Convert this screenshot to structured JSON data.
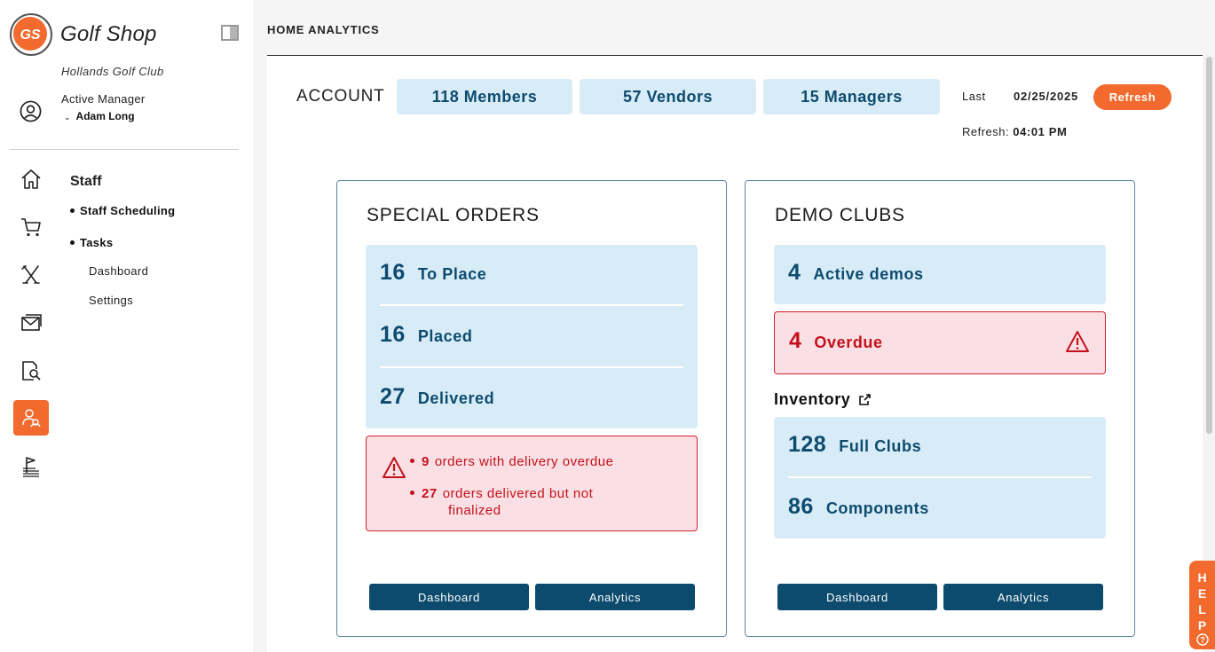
{
  "sidebar": {
    "logo_text": "GS",
    "brand": "Golf Shop",
    "club": "Hollands Golf Club",
    "manager_label": "Active Manager",
    "manager_name": "Adam Long",
    "section_title": "Staff",
    "items": [
      {
        "label": "Staff Scheduling"
      },
      {
        "label": "Tasks"
      }
    ],
    "subitems": [
      {
        "label": "Dashboard"
      },
      {
        "label": "Settings"
      }
    ],
    "nav_icons": [
      "home-icon",
      "cart-icon",
      "clubs-icon",
      "mail-icon",
      "search-doc-icon",
      "staff-icon",
      "flag-icon"
    ],
    "active_nav": "staff-icon"
  },
  "header": {
    "title": "HOME ANALYTICS"
  },
  "account": {
    "label": "ACCOUNT",
    "members": "118 Members",
    "vendors": "57 Vendors",
    "managers": "15 Managers",
    "last_label": "Last",
    "last_date": "02/25/2025",
    "refresh_button": "Refresh",
    "refresh_label": "Refresh:",
    "refresh_time": "04:01 PM"
  },
  "special_orders": {
    "title": "SPECIAL ORDERS",
    "rows": [
      {
        "num": "16",
        "label": "To Place"
      },
      {
        "num": "16",
        "label": "Placed"
      },
      {
        "num": "27",
        "label": "Delivered"
      }
    ],
    "alerts": [
      {
        "num": "9",
        "text": "orders with delivery overdue"
      },
      {
        "num": "27",
        "text": "orders delivered but not",
        "text2": "finalized"
      }
    ],
    "dashboard_button": "Dashboard",
    "analytics_button": "Analytics"
  },
  "demo_clubs": {
    "title": "DEMO CLUBS",
    "active": {
      "num": "4",
      "label": "Active demos"
    },
    "overdue": {
      "num": "4",
      "label": "Overdue"
    },
    "inventory_title": "Inventory",
    "inventory": [
      {
        "num": "128",
        "label": "Full Clubs"
      },
      {
        "num": "86",
        "label": "Components"
      }
    ],
    "dashboard_button": "Dashboard",
    "analytics_button": "Analytics"
  },
  "help": {
    "label": [
      "H",
      "E",
      "L",
      "P"
    ],
    "icon": "?"
  },
  "colors": {
    "accent": "#f26a2d",
    "primary": "#0d4b6e",
    "stat_bg": "#d8ecf8",
    "alert_bg": "#fae0e4",
    "alert_text": "#c4101c"
  }
}
